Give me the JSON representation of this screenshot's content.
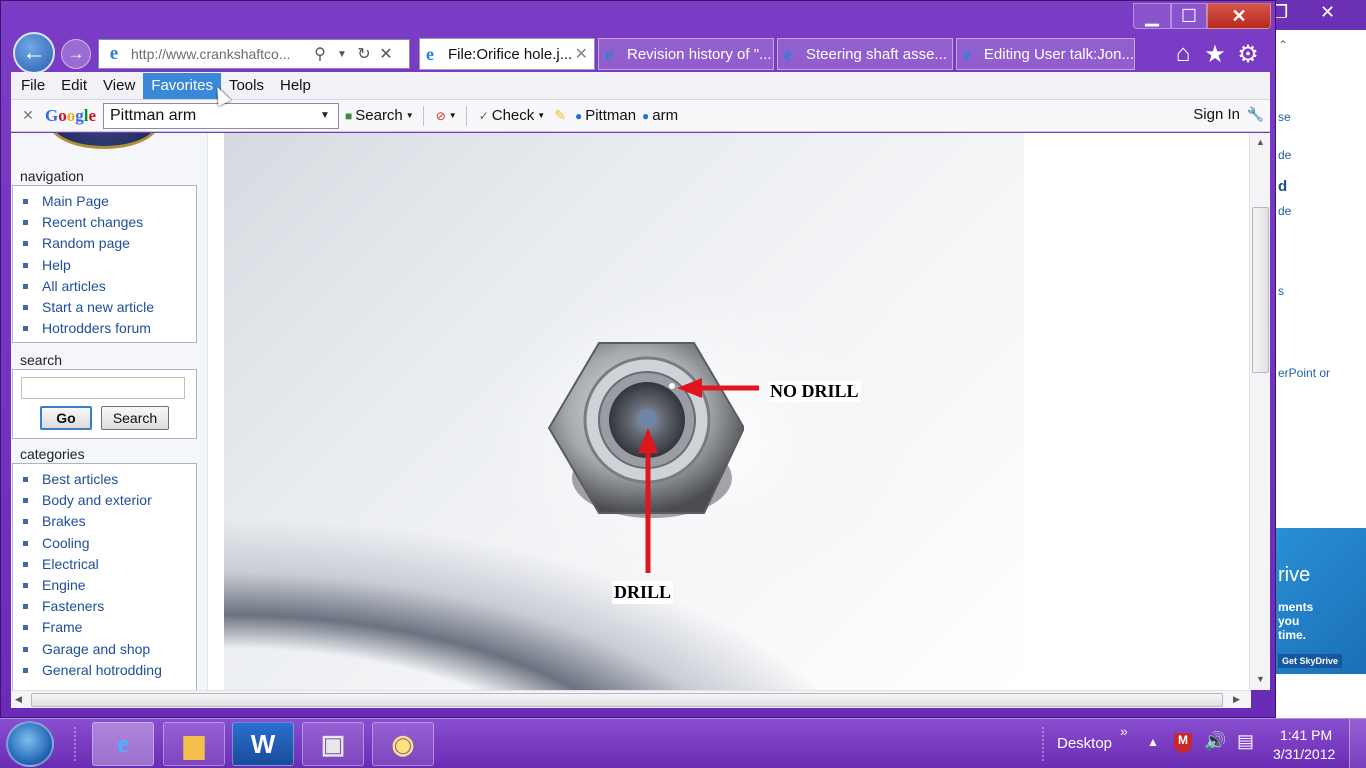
{
  "browser": {
    "address": "http://www.crankshaftco...",
    "tabs": [
      {
        "label": "File:Orifice hole.j...",
        "active": true
      },
      {
        "label": "Revision history of \"..."
      },
      {
        "label": "Steering shaft asse..."
      },
      {
        "label": "Editing User talk:Jon..."
      }
    ],
    "menu": [
      "File",
      "Edit",
      "View",
      "Favorites",
      "Tools",
      "Help"
    ],
    "menu_highlighted": "Favorites"
  },
  "google_toolbar": {
    "logo": "Google",
    "query": "Pittman arm",
    "search_label": "Search",
    "check_label": "Check",
    "term1": "Pittman",
    "term2": "arm",
    "sign_in": "Sign In"
  },
  "sidebar": {
    "navigation_title": "navigation",
    "navigation": [
      "Main Page",
      "Recent changes",
      "Random page",
      "Help",
      "All articles",
      "Start a new article",
      "Hotrodders forum"
    ],
    "search_title": "search",
    "go_label": "Go",
    "search_label": "Search",
    "categories_title": "categories",
    "categories": [
      "Best articles",
      "Body and exterior",
      "Brakes",
      "Cooling",
      "Electrical",
      "Engine",
      "Fasteners",
      "Frame",
      "Garage and shop",
      "General hotrodding"
    ]
  },
  "image": {
    "label_no_drill": "NO DRILL",
    "label_drill": "DRILL",
    "arrow_color": "#e0161e"
  },
  "background_window": {
    "fragments": [
      "se",
      "de",
      "d",
      "de",
      "s",
      "erPoint or"
    ],
    "ad_lines": [
      "rive",
      "ments",
      "you",
      "time."
    ],
    "ad_button": "Get SkyDrive"
  },
  "taskbar": {
    "desktop_label": "Desktop",
    "time": "1:41 PM",
    "date": "3/31/2012"
  }
}
